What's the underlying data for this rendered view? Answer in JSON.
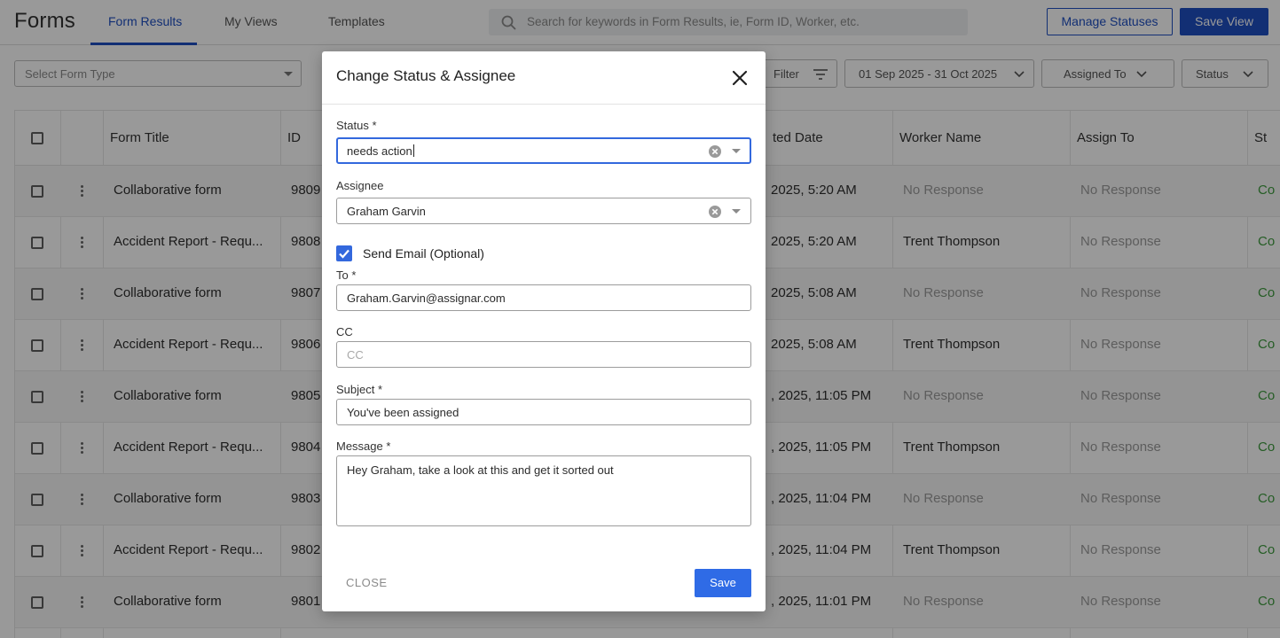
{
  "header": {
    "app_title": "Forms",
    "tabs": [
      {
        "label": "Form Results",
        "active": true
      },
      {
        "label": "My Views",
        "active": false
      },
      {
        "label": "Templates",
        "active": false
      }
    ],
    "search_placeholder": "Search for keywords in Form Results, ie, Form ID, Worker, etc.",
    "manage_statuses_label": "Manage Statuses",
    "save_view_label": "Save View"
  },
  "filters": {
    "form_type_placeholder": "Select Form Type",
    "filter_label": "Filter",
    "date_range": "01 Sep 2025 - 31 Oct 2025",
    "assigned_to_label": "Assigned To",
    "status_label": "Status"
  },
  "table": {
    "columns": [
      "Form Title",
      "ID",
      "ted Date",
      "Worker Name",
      "Assign To",
      "St"
    ],
    "rows": [
      {
        "title": "Collaborative form",
        "id": "9809",
        "date": "2025, 5:20 AM",
        "worker": "No Response",
        "assign": "No Response",
        "status": "Co"
      },
      {
        "title": "Accident Report - Requ...",
        "id": "9808",
        "date": "2025, 5:20 AM",
        "worker": "Trent Thompson",
        "assign": "No Response",
        "status": "Co"
      },
      {
        "title": "Collaborative form",
        "id": "9807",
        "date": "2025, 5:08 AM",
        "worker": "No Response",
        "assign": "No Response",
        "status": "Co"
      },
      {
        "title": "Accident Report - Requ...",
        "id": "9806",
        "date": "2025, 5:08 AM",
        "worker": "Trent Thompson",
        "assign": "No Response",
        "status": "Co"
      },
      {
        "title": "Collaborative form",
        "id": "9805",
        "date": ", 2025, 11:05 PM",
        "worker": "No Response",
        "assign": "No Response",
        "status": "Co"
      },
      {
        "title": "Accident Report - Requ...",
        "id": "9804",
        "date": ", 2025, 11:05 PM",
        "worker": "Trent Thompson",
        "assign": "No Response",
        "status": "Co"
      },
      {
        "title": "Collaborative form",
        "id": "9803",
        "date": ", 2025, 11:04 PM",
        "worker": "No Response",
        "assign": "No Response",
        "status": "Co"
      },
      {
        "title": "Accident Report - Requ...",
        "id": "9802",
        "date": ", 2025, 11:04 PM",
        "worker": "Trent Thompson",
        "assign": "No Response",
        "status": "Co"
      },
      {
        "title": "Collaborative form",
        "id": "9801",
        "date": ", 2025, 11:01 PM",
        "worker": "No Response",
        "assign": "No Response",
        "status": "Co"
      }
    ]
  },
  "modal": {
    "title": "Change Status & Assignee",
    "status_label": "Status *",
    "status_value": "needs action",
    "assignee_label": "Assignee",
    "assignee_value": "Graham Garvin",
    "send_email_label": "Send Email (Optional)",
    "send_email_checked": true,
    "to_label": "To *",
    "to_value": "Graham.Garvin@assignar.com",
    "cc_label": "CC",
    "cc_placeholder": "CC",
    "subject_label": "Subject *",
    "subject_value": "You've been assigned",
    "message_label": "Message *",
    "message_value": "Hey Graham, take a look at this and get it sorted out",
    "close_label": "CLOSE",
    "save_label": "Save"
  },
  "colors": {
    "primary": "#1f4fc1",
    "focus": "#3368dd",
    "save_button": "#2f6be6",
    "status_text": "#3e9b3e"
  }
}
